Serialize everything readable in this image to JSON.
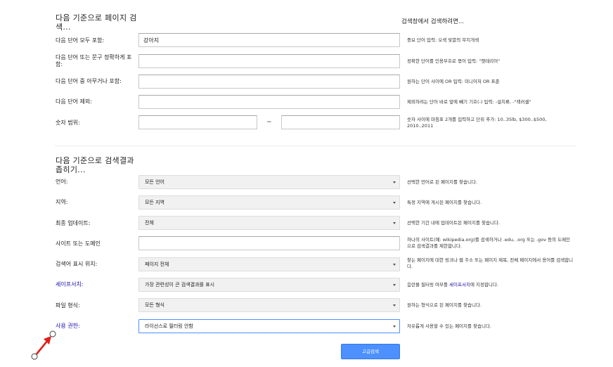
{
  "section1": {
    "title": "다음 기준으로 페이지 검색...",
    "right_heading": "검색창에서 검색하려면...",
    "rows": [
      {
        "label": "다음 단어 모두 포함:",
        "value": "강아지",
        "hint": "중요 단어 입력: 오색 빛깔의 무지개색"
      },
      {
        "label": "다음 단어 또는 문구 정확하게 포함:",
        "value": "",
        "hint": "정확한 단어를 인용부호로 묶어 입력: \"챗테리어\""
      },
      {
        "label": "다음 단어 중 아무거나 포함:",
        "value": "",
        "hint": "원하는 단어 사이에 OR 입력: 미니어처 OR 표준"
      },
      {
        "label": "다음 단어 제외:",
        "value": "",
        "hint": "제외하려는 단어 바로 앞에 빼기 기호(-) 입력: -설치류, -\"잭러셀\""
      }
    ],
    "range": {
      "label": "숫자 범위:",
      "from": "",
      "to": "",
      "separator": "~",
      "hint": "숫자 사이에 마침표 2개를 입력하고 단위 추가: 10..35lb, $300..$500, 2010..2011"
    }
  },
  "section2": {
    "title": "다음 기준으로 검색결과 좁히기...",
    "rows": [
      {
        "label": "언어:",
        "value": "모든 언어",
        "hint": "선택한 언어로 된 페이지를 찾습니다.",
        "type": "select"
      },
      {
        "label": "지역:",
        "value": "모든 지역",
        "hint": "특정 지역에 게시된 페이지를 찾습니다.",
        "type": "select"
      },
      {
        "label": "최종 업데이트:",
        "value": "전체",
        "hint": "선택한 기간 내에 업데이트된 페이지를 찾습니다.",
        "type": "select"
      },
      {
        "label": "사이트 또는 도메인",
        "value": "",
        "hint": "하나의 사이트(예: wikipedia.org)를 검색하거나 .edu, .org 또는 .gov 등의 도메인으로 검색결과를 제한합니다.",
        "type": "input"
      },
      {
        "label": "검색어 표시 위치:",
        "value": "페이지 전체",
        "hint": "찾는 페이지에 대한 링크나 웹 주소 또는 페이지 제목, 전체 페이지에서 용어를 검색합니다.",
        "type": "select"
      },
      {
        "label": "세이프서치:",
        "value": "가장 관련성이 큰 검색결과를 표시",
        "hint_pre": "음란물 필터링 여부를 ",
        "hint_link": "세이프서치",
        "hint_post": "에 지정합니다.",
        "type": "select"
      },
      {
        "label": "파일 형식:",
        "value": "모든 형식",
        "hint": "원하는 형식으로 된 페이지를 찾습니다.",
        "type": "select"
      },
      {
        "label": "사용 권한:",
        "value": "라이선스로 필터링 안함",
        "hint": "자유롭게 사용할 수 있는 페이지를 찾습니다.",
        "type": "select"
      }
    ]
  },
  "submit_label": "고급검색",
  "colors": {
    "accent": "#4d90fe",
    "link": "#1a0dab",
    "pointer": "#e0201b"
  },
  "icons": {
    "pointer": "red-arrow-pointer-icon",
    "caret": "caret-down-icon"
  }
}
